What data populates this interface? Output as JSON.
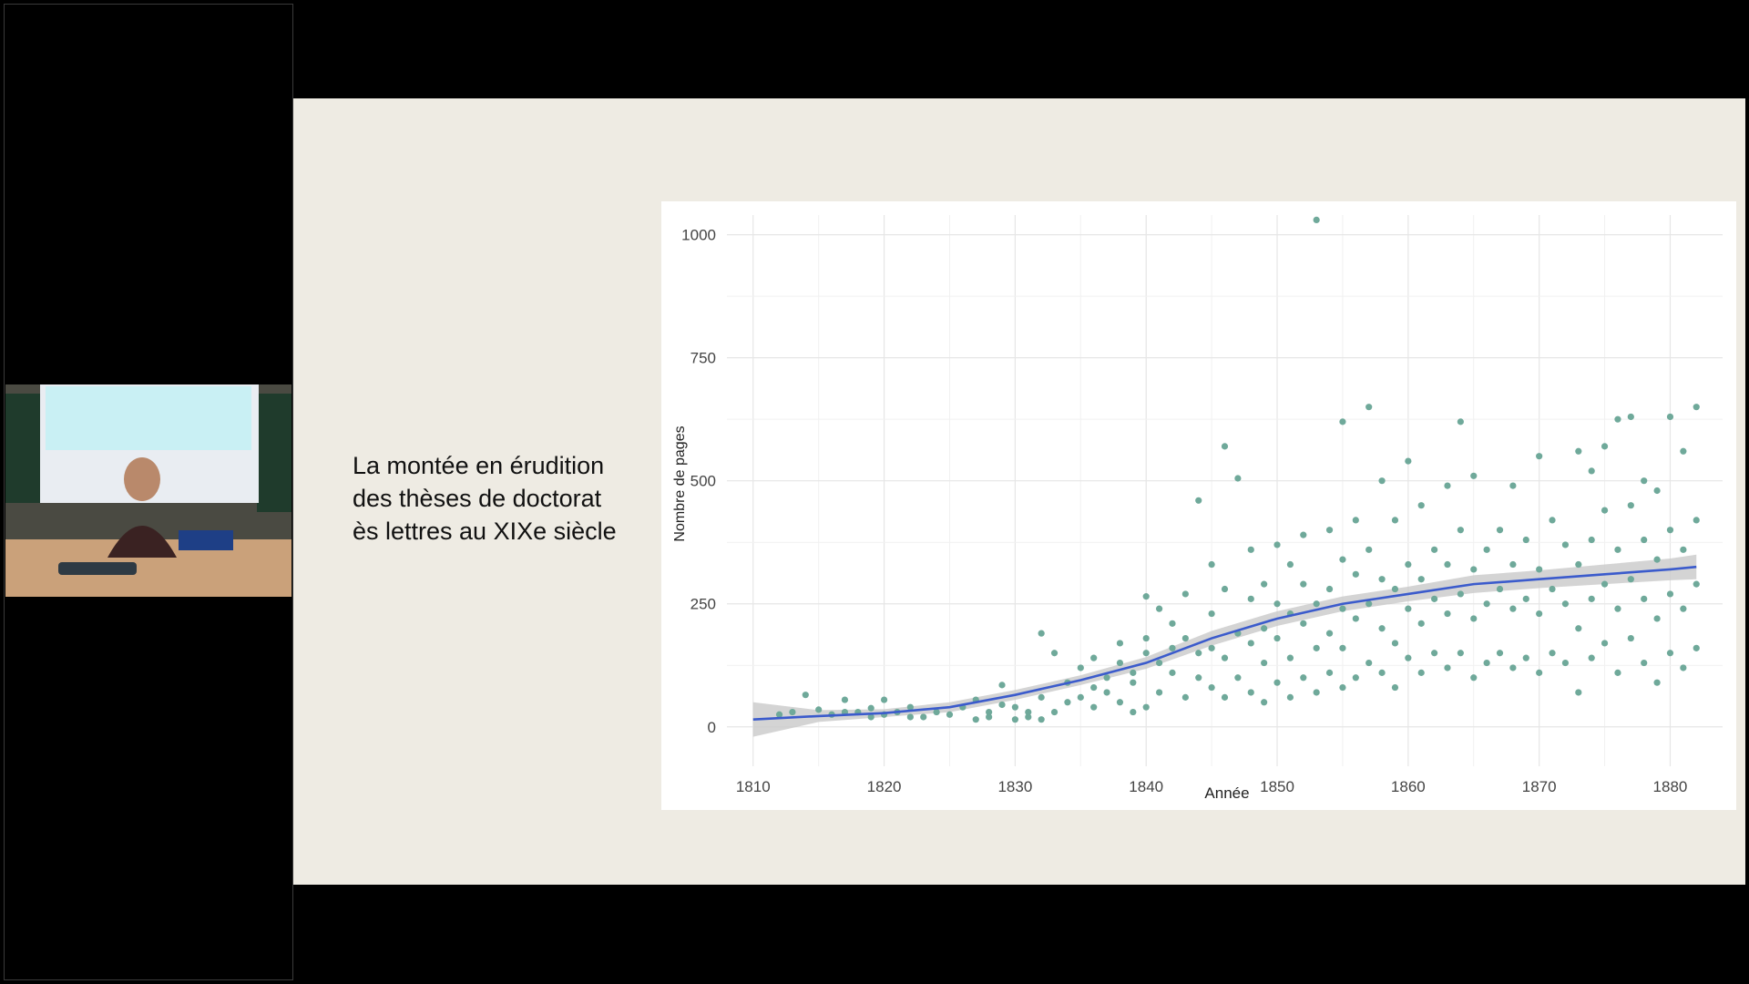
{
  "slide": {
    "title_lines": [
      "La montée en érudition",
      "des thèses de doctorat",
      "ès lettres au XIXe siècle"
    ]
  },
  "colors": {
    "slide_bg": "#eeebe3",
    "points": "#6fa99a",
    "trend": "#3b5bcc",
    "band": "#c9c9c9"
  },
  "chart_data": {
    "type": "scatter",
    "title": "",
    "xlabel": "Année",
    "ylabel": "Nombre de pages",
    "xlim": [
      1808,
      1884
    ],
    "ylim": [
      -80,
      1040
    ],
    "x_ticks": [
      1810,
      1820,
      1830,
      1840,
      1850,
      1860,
      1870,
      1880
    ],
    "y_ticks": [
      0,
      250,
      500,
      750,
      1000
    ],
    "grid": true,
    "legend": "none",
    "trend": {
      "x": [
        1810,
        1815,
        1820,
        1825,
        1830,
        1835,
        1840,
        1845,
        1850,
        1855,
        1860,
        1865,
        1870,
        1875,
        1880,
        1882
      ],
      "y": [
        15,
        22,
        28,
        40,
        65,
        95,
        130,
        180,
        220,
        250,
        270,
        290,
        300,
        310,
        320,
        325
      ],
      "lower": [
        -20,
        10,
        20,
        30,
        55,
        85,
        118,
        165,
        205,
        235,
        255,
        272,
        282,
        290,
        298,
        300
      ],
      "upper": [
        50,
        34,
        36,
        50,
        75,
        105,
        142,
        195,
        235,
        265,
        285,
        308,
        318,
        330,
        342,
        350
      ]
    },
    "points": [
      [
        1812,
        25
      ],
      [
        1813,
        30
      ],
      [
        1814,
        65
      ],
      [
        1815,
        35
      ],
      [
        1816,
        25
      ],
      [
        1817,
        30
      ],
      [
        1817,
        55
      ],
      [
        1818,
        30
      ],
      [
        1819,
        20
      ],
      [
        1819,
        38
      ],
      [
        1820,
        25
      ],
      [
        1820,
        55
      ],
      [
        1821,
        30
      ],
      [
        1822,
        20
      ],
      [
        1822,
        40
      ],
      [
        1823,
        20
      ],
      [
        1824,
        30
      ],
      [
        1825,
        25
      ],
      [
        1826,
        40
      ],
      [
        1827,
        15
      ],
      [
        1827,
        55
      ],
      [
        1828,
        20
      ],
      [
        1828,
        30
      ],
      [
        1829,
        45
      ],
      [
        1829,
        85
      ],
      [
        1830,
        15
      ],
      [
        1830,
        40
      ],
      [
        1831,
        20
      ],
      [
        1831,
        30
      ],
      [
        1832,
        15
      ],
      [
        1832,
        60
      ],
      [
        1832,
        190
      ],
      [
        1833,
        30
      ],
      [
        1833,
        150
      ],
      [
        1834,
        50
      ],
      [
        1834,
        90
      ],
      [
        1835,
        60
      ],
      [
        1835,
        120
      ],
      [
        1836,
        40
      ],
      [
        1836,
        80
      ],
      [
        1836,
        140
      ],
      [
        1837,
        70
      ],
      [
        1837,
        100
      ],
      [
        1838,
        50
      ],
      [
        1838,
        130
      ],
      [
        1838,
        170
      ],
      [
        1839,
        30
      ],
      [
        1839,
        90
      ],
      [
        1839,
        110
      ],
      [
        1840,
        40
      ],
      [
        1840,
        150
      ],
      [
        1840,
        180
      ],
      [
        1840,
        265
      ],
      [
        1841,
        70
      ],
      [
        1841,
        130
      ],
      [
        1841,
        240
      ],
      [
        1842,
        110
      ],
      [
        1842,
        160
      ],
      [
        1842,
        210
      ],
      [
        1843,
        60
      ],
      [
        1843,
        180
      ],
      [
        1843,
        270
      ],
      [
        1844,
        100
      ],
      [
        1844,
        150
      ],
      [
        1844,
        460
      ],
      [
        1845,
        80
      ],
      [
        1845,
        160
      ],
      [
        1845,
        230
      ],
      [
        1845,
        330
      ],
      [
        1846,
        60
      ],
      [
        1846,
        140
      ],
      [
        1846,
        280
      ],
      [
        1846,
        570
      ],
      [
        1847,
        100
      ],
      [
        1847,
        190
      ],
      [
        1847,
        505
      ],
      [
        1848,
        70
      ],
      [
        1848,
        170
      ],
      [
        1848,
        260
      ],
      [
        1848,
        360
      ],
      [
        1849,
        50
      ],
      [
        1849,
        130
      ],
      [
        1849,
        200
      ],
      [
        1849,
        290
      ],
      [
        1850,
        90
      ],
      [
        1850,
        180
      ],
      [
        1850,
        250
      ],
      [
        1850,
        370
      ],
      [
        1851,
        60
      ],
      [
        1851,
        140
      ],
      [
        1851,
        230
      ],
      [
        1851,
        330
      ],
      [
        1852,
        100
      ],
      [
        1852,
        210
      ],
      [
        1852,
        290
      ],
      [
        1852,
        390
      ],
      [
        1853,
        70
      ],
      [
        1853,
        160
      ],
      [
        1853,
        250
      ],
      [
        1853,
        1030
      ],
      [
        1854,
        110
      ],
      [
        1854,
        190
      ],
      [
        1854,
        280
      ],
      [
        1854,
        400
      ],
      [
        1855,
        80
      ],
      [
        1855,
        160
      ],
      [
        1855,
        240
      ],
      [
        1855,
        340
      ],
      [
        1855,
        620
      ],
      [
        1856,
        100
      ],
      [
        1856,
        220
      ],
      [
        1856,
        310
      ],
      [
        1856,
        420
      ],
      [
        1857,
        130
      ],
      [
        1857,
        250
      ],
      [
        1857,
        360
      ],
      [
        1857,
        650
      ],
      [
        1858,
        110
      ],
      [
        1858,
        200
      ],
      [
        1858,
        300
      ],
      [
        1858,
        500
      ],
      [
        1859,
        80
      ],
      [
        1859,
        170
      ],
      [
        1859,
        280
      ],
      [
        1859,
        420
      ],
      [
        1860,
        140
      ],
      [
        1860,
        240
      ],
      [
        1860,
        330
      ],
      [
        1860,
        540
      ],
      [
        1861,
        110
      ],
      [
        1861,
        210
      ],
      [
        1861,
        300
      ],
      [
        1861,
        450
      ],
      [
        1862,
        150
      ],
      [
        1862,
        260
      ],
      [
        1862,
        360
      ],
      [
        1863,
        120
      ],
      [
        1863,
        230
      ],
      [
        1863,
        330
      ],
      [
        1863,
        490
      ],
      [
        1864,
        150
      ],
      [
        1864,
        270
      ],
      [
        1864,
        400
      ],
      [
        1864,
        620
      ],
      [
        1865,
        100
      ],
      [
        1865,
        220
      ],
      [
        1865,
        320
      ],
      [
        1865,
        510
      ],
      [
        1866,
        130
      ],
      [
        1866,
        250
      ],
      [
        1866,
        360
      ],
      [
        1867,
        150
      ],
      [
        1867,
        280
      ],
      [
        1867,
        400
      ],
      [
        1868,
        120
      ],
      [
        1868,
        240
      ],
      [
        1868,
        330
      ],
      [
        1868,
        490
      ],
      [
        1869,
        140
      ],
      [
        1869,
        260
      ],
      [
        1869,
        380
      ],
      [
        1870,
        110
      ],
      [
        1870,
        230
      ],
      [
        1870,
        320
      ],
      [
        1870,
        550
      ],
      [
        1871,
        150
      ],
      [
        1871,
        280
      ],
      [
        1871,
        420
      ],
      [
        1872,
        130
      ],
      [
        1872,
        250
      ],
      [
        1872,
        370
      ],
      [
        1873,
        70
      ],
      [
        1873,
        200
      ],
      [
        1873,
        330
      ],
      [
        1873,
        560
      ],
      [
        1874,
        140
      ],
      [
        1874,
        260
      ],
      [
        1874,
        380
      ],
      [
        1874,
        520
      ],
      [
        1875,
        170
      ],
      [
        1875,
        290
      ],
      [
        1875,
        440
      ],
      [
        1875,
        570
      ],
      [
        1876,
        110
      ],
      [
        1876,
        240
      ],
      [
        1876,
        360
      ],
      [
        1876,
        625
      ],
      [
        1877,
        180
      ],
      [
        1877,
        300
      ],
      [
        1877,
        450
      ],
      [
        1877,
        630
      ],
      [
        1878,
        130
      ],
      [
        1878,
        260
      ],
      [
        1878,
        380
      ],
      [
        1878,
        500
      ],
      [
        1879,
        90
      ],
      [
        1879,
        220
      ],
      [
        1879,
        340
      ],
      [
        1879,
        480
      ],
      [
        1880,
        150
      ],
      [
        1880,
        270
      ],
      [
        1880,
        400
      ],
      [
        1880,
        630
      ],
      [
        1881,
        120
      ],
      [
        1881,
        240
      ],
      [
        1881,
        360
      ],
      [
        1881,
        560
      ],
      [
        1882,
        160
      ],
      [
        1882,
        290
      ],
      [
        1882,
        420
      ],
      [
        1882,
        650
      ]
    ]
  }
}
